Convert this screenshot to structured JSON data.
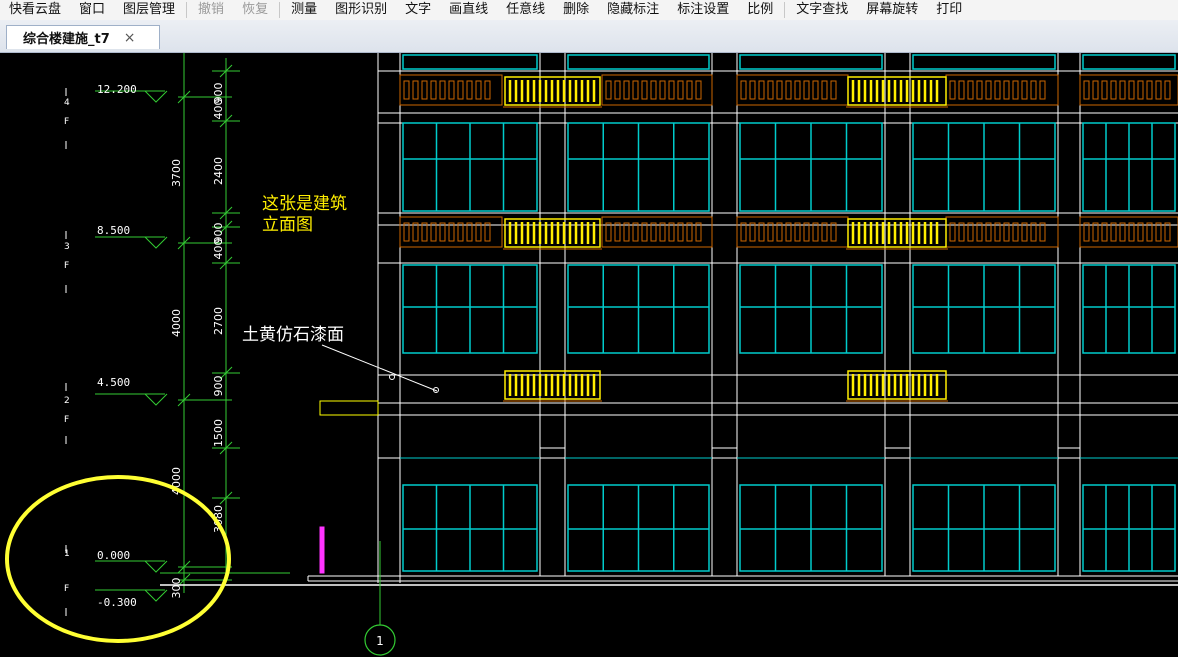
{
  "menu": {
    "items": [
      {
        "label": "快看云盘",
        "enabled": true
      },
      {
        "label": "窗口",
        "enabled": true
      },
      {
        "label": "图层管理",
        "enabled": true
      },
      {
        "label": "撤销",
        "enabled": false
      },
      {
        "label": "恢复",
        "enabled": false
      },
      {
        "label": "测量",
        "enabled": true
      },
      {
        "label": "图形识别",
        "enabled": true
      },
      {
        "label": "文字",
        "enabled": true
      },
      {
        "label": "画直线",
        "enabled": true
      },
      {
        "label": "任意线",
        "enabled": true
      },
      {
        "label": "删除",
        "enabled": true
      },
      {
        "label": "隐藏标注",
        "enabled": true
      },
      {
        "label": "标注设置",
        "enabled": true
      },
      {
        "label": "比例",
        "enabled": true
      },
      {
        "label": "文字查找",
        "enabled": true
      },
      {
        "label": "屏幕旋转",
        "enabled": true
      },
      {
        "label": "打印",
        "enabled": true
      }
    ]
  },
  "tab": {
    "title": "综合楼建施_t7",
    "close": "×"
  },
  "drawing": {
    "levels": [
      "12.200",
      "8.500",
      "4.500",
      "0.000",
      "-0.300"
    ],
    "floor_tags": [
      "4",
      "F",
      "3",
      "F",
      "2",
      "F",
      "1",
      "F"
    ],
    "dims_outer": [
      "3700",
      "4000",
      "4000",
      "300"
    ],
    "dims_inner": [
      "400",
      "900",
      "2400",
      "400",
      "900",
      "2700",
      "900",
      "1500",
      "3080"
    ],
    "annotation_lines": [
      "这张是建筑",
      "立面图"
    ],
    "material_note": "土黄仿石漆面",
    "axis_label": "1",
    "colors": {
      "background": "#000000",
      "dim_line": "#33cc33",
      "wall": "#ffffff",
      "window": "#00cccc",
      "rail_orange": "#cc6600",
      "rail_yellow": "#ffee00",
      "highlight": "#ffff33",
      "magenta": "#ff33ff"
    }
  }
}
